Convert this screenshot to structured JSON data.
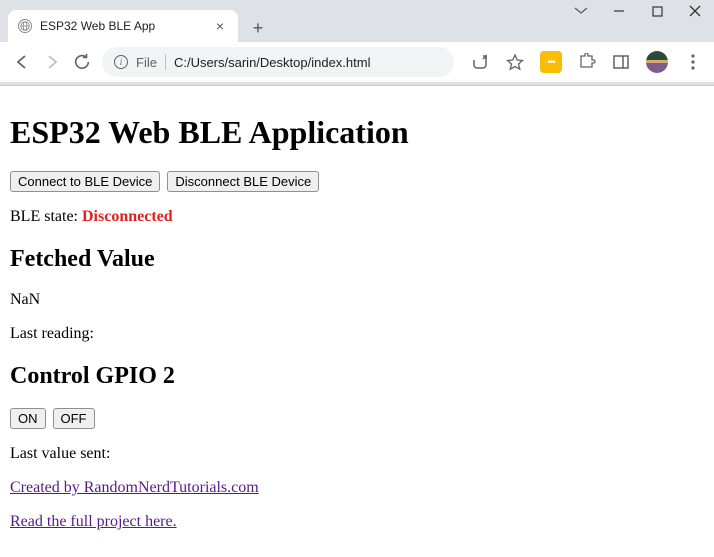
{
  "tab": {
    "title": "ESP32 Web BLE App"
  },
  "url": {
    "prefix_label": "File",
    "path": "C:/Users/sarin/Desktop/index.html"
  },
  "page": {
    "heading": "ESP32 Web BLE Application",
    "connect_btn": "Connect to BLE Device",
    "disconnect_btn": "Disconnect BLE Device",
    "ble_state_label": "BLE state: ",
    "ble_state_value": "Disconnected",
    "fetched_heading": "Fetched Value",
    "fetched_value": "NaN",
    "last_reading_label": "Last reading:",
    "gpio_heading": "Control GPIO 2",
    "on_btn": "ON",
    "off_btn": "OFF",
    "last_value_sent_label": "Last value sent:",
    "link1": "Created by RandomNerdTutorials.com",
    "link2": "Read the full project here."
  }
}
